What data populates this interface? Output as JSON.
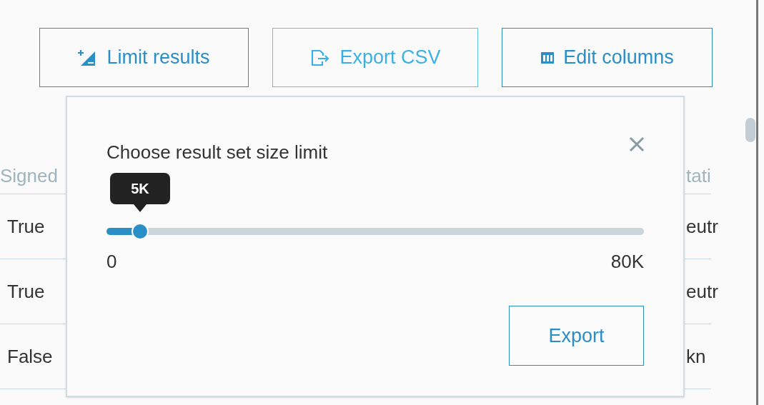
{
  "toolbar": [
    {
      "kind": "limit",
      "label": "Limit results",
      "focused": false
    },
    {
      "kind": "export",
      "label": "Export CSV",
      "focused": true
    },
    {
      "kind": "columns",
      "label": "Edit columns",
      "focused": false
    }
  ],
  "table": {
    "columns": [
      "Signed",
      "tati"
    ],
    "rows": [
      {
        "cells": [
          "True",
          "eutr"
        ]
      },
      {
        "cells": [
          "True",
          "eutr"
        ]
      },
      {
        "cells": [
          "False",
          "kn"
        ]
      }
    ]
  },
  "popover": {
    "title": "Choose result set size limit",
    "slider": {
      "level": 0.0625,
      "tooltip": "5K",
      "min_label": "0",
      "max_label": "80K"
    },
    "button": "Export"
  }
}
